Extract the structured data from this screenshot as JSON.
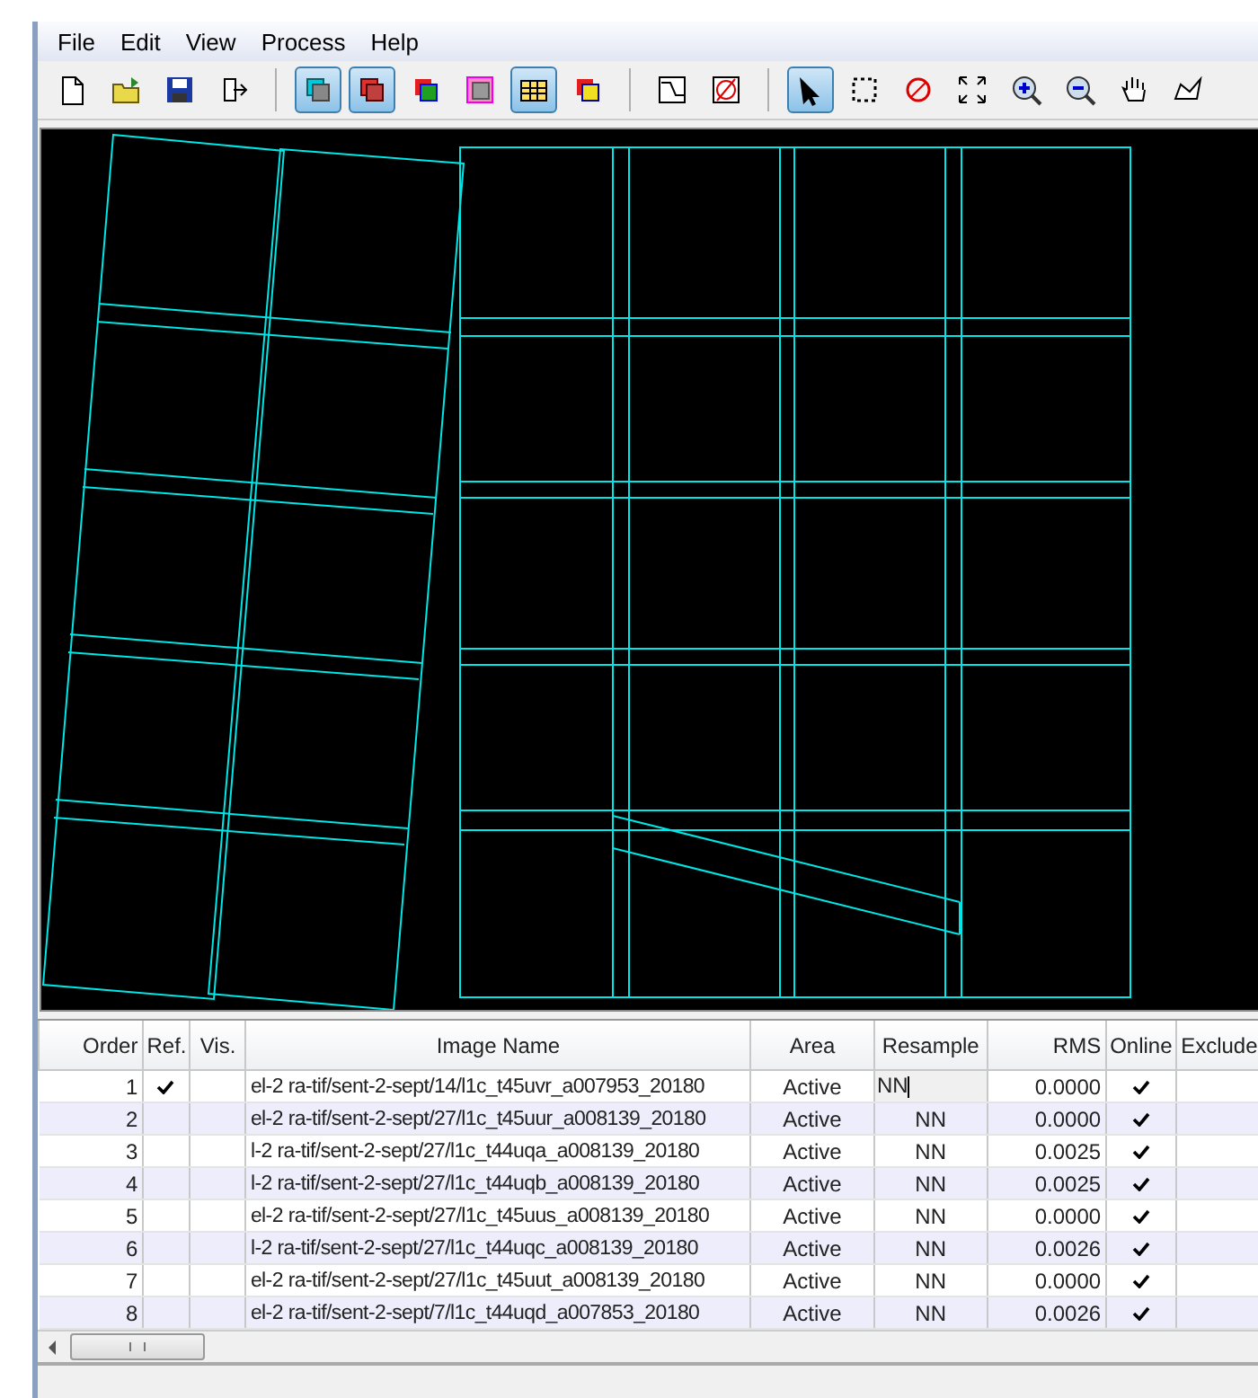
{
  "menu": [
    "File",
    "Edit",
    "View",
    "Process",
    "Help"
  ],
  "toolbar": [
    [
      {
        "selected": false
      },
      {
        "selected": false
      },
      {
        "selected": false
      },
      {
        "selected": false
      }
    ],
    [
      {
        "selected": true
      },
      {
        "selected": true
      },
      {
        "selected": false
      },
      {
        "selected": false
      },
      {
        "selected": true
      },
      {
        "selected": false
      }
    ],
    [
      {
        "selected": false
      },
      {
        "selected": false
      }
    ],
    [
      {
        "selected": true
      },
      {
        "selected": false
      },
      {
        "selected": false
      },
      {
        "selected": false
      },
      {
        "selected": false
      },
      {
        "selected": false
      },
      {
        "selected": false
      },
      {
        "selected": false
      }
    ]
  ],
  "table": {
    "columns": [
      "Order",
      "Ref.",
      "Vis.",
      "Image Name",
      "Area",
      "Resample",
      "RMS",
      "Online",
      "Exclude"
    ],
    "rows": [
      {
        "order": "1",
        "ref": true,
        "name": "el-2 ra-tif/sent-2-sept/14/l1c_t45uvr_a007953_20180",
        "area": "Active",
        "resample": "NN",
        "editing": true,
        "rms": "0.0000",
        "online": true
      },
      {
        "order": "2",
        "ref": false,
        "name": "el-2 ra-tif/sent-2-sept/27/l1c_t45uur_a008139_20180",
        "area": "Active",
        "resample": "NN",
        "editing": false,
        "rms": "0.0000",
        "online": true
      },
      {
        "order": "3",
        "ref": false,
        "name": "l-2 ra-tif/sent-2-sept/27/l1c_t44uqa_a008139_20180",
        "area": "Active",
        "resample": "NN",
        "editing": false,
        "rms": "0.0025",
        "online": true
      },
      {
        "order": "4",
        "ref": false,
        "name": "l-2 ra-tif/sent-2-sept/27/l1c_t44uqb_a008139_20180",
        "area": "Active",
        "resample": "NN",
        "editing": false,
        "rms": "0.0025",
        "online": true
      },
      {
        "order": "5",
        "ref": false,
        "name": "el-2 ra-tif/sent-2-sept/27/l1c_t45uus_a008139_20180",
        "area": "Active",
        "resample": "NN",
        "editing": false,
        "rms": "0.0000",
        "online": true
      },
      {
        "order": "6",
        "ref": false,
        "name": "l-2 ra-tif/sent-2-sept/27/l1c_t44uqc_a008139_20180",
        "area": "Active",
        "resample": "NN",
        "editing": false,
        "rms": "0.0026",
        "online": true
      },
      {
        "order": "7",
        "ref": false,
        "name": "el-2 ra-tif/sent-2-sept/27/l1c_t45uut_a008139_20180",
        "area": "Active",
        "resample": "NN",
        "editing": false,
        "rms": "0.0000",
        "online": true
      },
      {
        "order": "8",
        "ref": false,
        "name": "el-2 ra-tif/sent-2-sept/7/l1c_t44uqd_a007853_20180",
        "area": "Active",
        "resample": "NN",
        "editing": false,
        "rms": "0.0026",
        "online": true
      }
    ]
  }
}
